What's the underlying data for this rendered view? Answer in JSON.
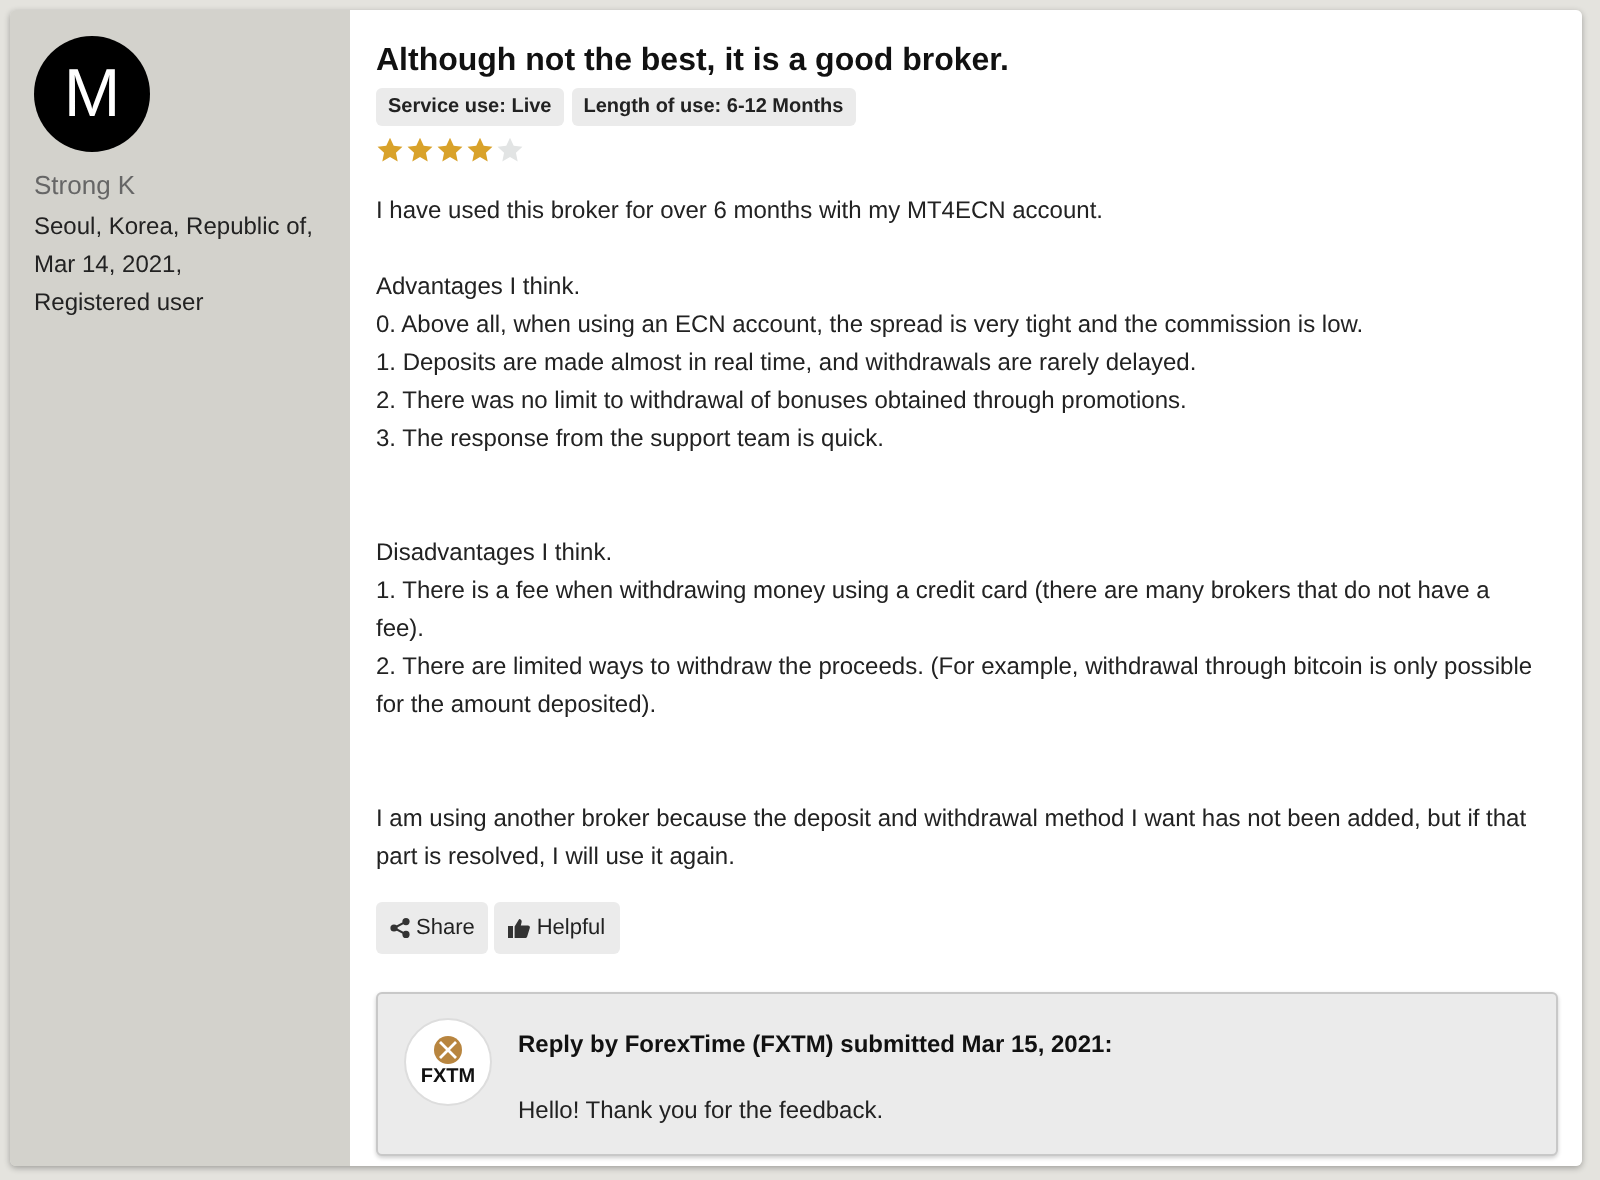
{
  "author": {
    "initial": "M",
    "name": "Strong K",
    "details": [
      "Seoul, Korea, Republic of,",
      "Mar 14, 2021,",
      "Registered user"
    ]
  },
  "review": {
    "title": "Although not the best, it is a good broker.",
    "tags": [
      "Service use: Live",
      "Length of use: 6-12 Months"
    ],
    "stars": 4,
    "paragraphs": [
      [
        "I have used this broker for over 6 months with my MT4ECN account."
      ],
      [
        "Advantages I think.",
        "0. Above all, when using an ECN account, the spread is very tight and the commission is low.",
        "1. Deposits are made almost in real time, and withdrawals are rarely delayed.",
        "2. There was no limit to withdrawal of bonuses obtained through promotions.",
        "3. The response from the support team is quick."
      ],
      [
        "Disadvantages I think.",
        "1. There is a fee when withdrawing money using a credit card (there are many brokers that do not have a fee).",
        "2. There are limited ways to withdraw the proceeds. (For example, withdrawal through bitcoin is only possible for the amount deposited)."
      ],
      [
        "I am using another broker because the deposit and withdrawal method I want has not been added, but if that part is resolved, I will use it again."
      ]
    ],
    "actions": [
      {
        "kind": "share",
        "label": "Share"
      },
      {
        "kind": "helpful",
        "label": "Helpful"
      }
    ]
  },
  "reply": {
    "logo_text": "FXTM",
    "heading": "Reply by ForexTime (FXTM) submitted Mar 15, 2021:",
    "text": "Hello! Thank you for the feedback."
  }
}
